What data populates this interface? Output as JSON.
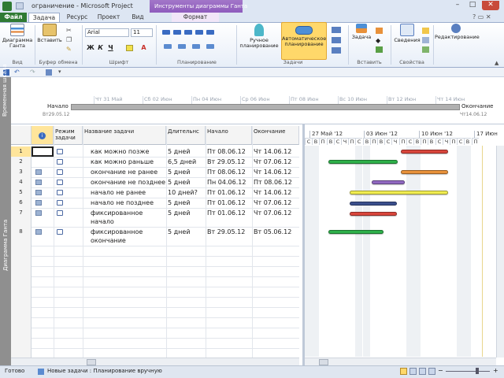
{
  "window": {
    "title": "ограничение - Microsoft Project",
    "context_header": "Инструменты диаграммы Ганта"
  },
  "tabs": [
    "Файл",
    "Задача",
    "Ресурс",
    "Проект",
    "Вид",
    "Формат"
  ],
  "ribbon": {
    "view_btn": "Диаграмма Ганта",
    "paste_btn": "Вставить",
    "font_name": "Arial",
    "font_size": "11",
    "bold": "Ж",
    "italic": "К",
    "underline": "Ч",
    "manual_btn": "Ручное планирование",
    "auto_btn": "Автоматическое планирование",
    "task_btn": "Задача",
    "info_btn": "Сведения",
    "edit_btn": "Редактирование",
    "groups": {
      "view": "Вид",
      "clipboard": "Буфер обмена",
      "font": "Шрифт",
      "schedule": "Планирование",
      "tasks": "Задачи",
      "insert": "Вставить",
      "properties": "Свойства"
    }
  },
  "timeline": {
    "sidebar_label": "Временная шкала",
    "start_label": "Начало",
    "start_date": "Вт29.05.12",
    "end_label": "Окончание",
    "end_date": "Чт14.06.12",
    "dates": [
      "Чт 31 Май",
      "Сб 02 Июн",
      "Пн 04 Июн",
      "Ср 06 Июн",
      "Пт 08 Июн",
      "Вс 10 Июн",
      "Вт 12 Июн",
      "Чт 14 Июн"
    ]
  },
  "grid": {
    "sidebar_label": "Диаграмма Ганта",
    "headers": {
      "mode": "Режим задачи",
      "name": "Название задачи",
      "duration": "Длительнс",
      "start": "Начало",
      "finish": "Окончание"
    },
    "rows": [
      {
        "id": "1",
        "name": "как можно позже",
        "duration": "5 дней",
        "start": "Пт 08.06.12",
        "finish": "Чт 14.06.12"
      },
      {
        "id": "2",
        "name": "как можно раньше",
        "duration": "6,5 дней",
        "start": "Вт 29.05.12",
        "finish": "Чт 07.06.12"
      },
      {
        "id": "3",
        "name": "окончание не ранее",
        "duration": "5 дней",
        "start": "Пт 08.06.12",
        "finish": "Чт 14.06.12"
      },
      {
        "id": "4",
        "name": "окончание не позднее",
        "duration": "5 дней",
        "start": "Пн 04.06.12",
        "finish": "Пт 08.06.12"
      },
      {
        "id": "5",
        "name": "начало не ранее",
        "duration": "10 дней?",
        "start": "Пт 01.06.12",
        "finish": "Чт 14.06.12"
      },
      {
        "id": "6",
        "name": "начало не позднее",
        "duration": "5 дней",
        "start": "Пт 01.06.12",
        "finish": "Чт 07.06.12"
      },
      {
        "id": "7",
        "name": "фиксированное начало",
        "duration": "5 дней",
        "start": "Пт 01.06.12",
        "finish": "Чт 07.06.12"
      },
      {
        "id": "8",
        "name": "фиксированное окончание",
        "duration": "5 дней",
        "start": "Вт 29.05.12",
        "finish": "Вт 05.06.12"
      }
    ]
  },
  "chart": {
    "weeks": [
      "27 Май '12",
      "03 Июн '12",
      "10 Июн '12",
      "17 Июн"
    ],
    "days": [
      "С",
      "В",
      "П",
      "В",
      "С",
      "Ч",
      "П",
      "С",
      "В",
      "П",
      "В",
      "С",
      "Ч",
      "П",
      "С",
      "В",
      "П",
      "В",
      "С",
      "Ч",
      "П",
      "С",
      "В",
      "П"
    ],
    "colors": {
      "red": "#d9463c",
      "green": "#2eb04a",
      "orange": "#e8913a",
      "purple": "#9068c0",
      "yellow": "#f0ec50",
      "navy": "#3a4f8c"
    }
  },
  "status": {
    "ready": "Готово",
    "new_tasks": "Новые задачи : Планирование вручную"
  }
}
